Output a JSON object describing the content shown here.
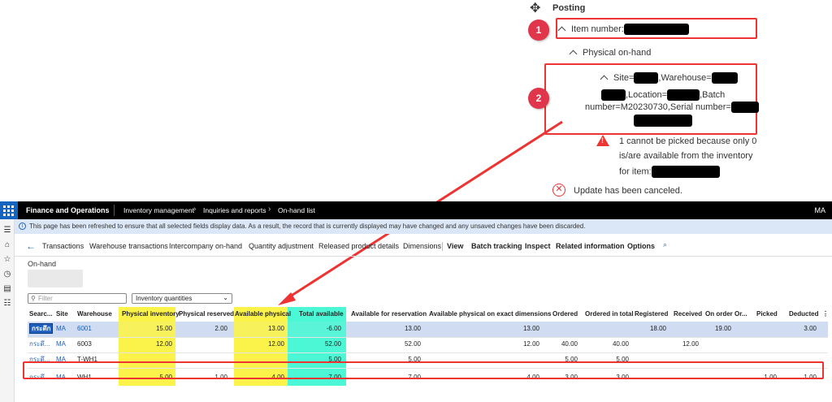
{
  "posting": {
    "title": "Posting",
    "item_number_label": "Item number:",
    "physical_onhand_label": "Physical on-hand",
    "dim_site": "Site=",
    "dim_warehouse": ",Warehouse=",
    "dim_location": ",Location=",
    "dim_batch_1": ",Batch",
    "dim_batch_2": "number=M20230730,Serial number=",
    "warning_1": "1 cannot be picked because only 0",
    "warning_2": "is/are available from the inventory",
    "warning_3": "for item:",
    "cancel_text": "Update has been canceled.",
    "badge_1": "1",
    "badge_2": "2"
  },
  "topbar": {
    "app_name": "Finance and Operations",
    "breadcrumb": [
      "Inventory management",
      "Inquiries and reports",
      "On-hand list"
    ],
    "user": "MA"
  },
  "infobar": {
    "message": "This page has been refreshed to ensure that all selected fields display data. As a result, the record that is currently displayed may have changed and any unsaved changes have been discarded."
  },
  "actions": {
    "transactions": "Transactions",
    "warehouse_transactions": "Warehouse transactions",
    "intercompany": "Intercompany on-hand",
    "quantity_adjustment": "Quantity adjustment",
    "released_product": "Released product details",
    "dimensions": "Dimensions",
    "view": "View",
    "batch_tracking": "Batch tracking",
    "inspect": "Inspect",
    "related": "Related information",
    "options": "Options"
  },
  "page": {
    "label": "On-hand"
  },
  "filter": {
    "placeholder": "Filter"
  },
  "view_select": {
    "value": "Inventory quantities"
  },
  "grid": {
    "headers": {
      "search": "Searc...",
      "site": "Site",
      "warehouse": "Warehouse",
      "physical_inventory": "Physical inventory",
      "physical_reserved": "Physical reserved",
      "available_physical": "Available physical",
      "total_available": "Total available",
      "available_for_reservation": "Available for reservation",
      "available_physical_exact": "Available physical on exact dimensions",
      "ordered": "Ordered",
      "ordered_in_total": "Ordered in total",
      "registered": "Registered",
      "received": "Received",
      "on_order": "On order",
      "or": "Or...",
      "picked": "Picked",
      "deducted": "Deducted"
    },
    "rows": [
      {
        "search": "กระดึก",
        "site": "MA",
        "warehouse": "6001",
        "physical_inventory": "15.00",
        "physical_reserved": "2.00",
        "available_physical": "13.00",
        "total_available": "-6.00",
        "available_for_reservation": "13.00",
        "available_physical_exact": "13.00",
        "ordered": "",
        "ordered_in_total": "",
        "registered": "18.00",
        "received": "",
        "on_order": "19.00",
        "picked": "",
        "deducted": "3.00"
      },
      {
        "search": "กระดึ...",
        "site": "MA",
        "warehouse": "6003",
        "physical_inventory": "12.00",
        "physical_reserved": "",
        "available_physical": "12.00",
        "total_available": "52.00",
        "available_for_reservation": "52.00",
        "available_physical_exact": "12.00",
        "ordered": "40.00",
        "ordered_in_total": "40.00",
        "registered": "",
        "received": "12.00",
        "on_order": "",
        "picked": "",
        "deducted": ""
      },
      {
        "search": "กระดึ...",
        "site": "MA",
        "warehouse": "T-WH1",
        "physical_inventory": "",
        "physical_reserved": "",
        "available_physical": "",
        "total_available": "5.00",
        "available_for_reservation": "5.00",
        "available_physical_exact": "",
        "ordered": "5.00",
        "ordered_in_total": "5.00",
        "registered": "",
        "received": "",
        "on_order": "",
        "picked": "",
        "deducted": ""
      },
      {
        "search": "กระดึ...",
        "site": "MA",
        "warehouse": "WH1",
        "physical_inventory": "5.00",
        "physical_reserved": "1.00",
        "available_physical": "4.00",
        "total_available": "7.00",
        "available_for_reservation": "7.00",
        "available_physical_exact": "4.00",
        "ordered": "3.00",
        "ordered_in_total": "3.00",
        "registered": "",
        "received": "",
        "on_order": "",
        "picked": "1.00",
        "deducted": "1.00"
      }
    ]
  },
  "colors": {
    "annotation_red": "#e33333",
    "highlight_yellow": "#fbf34a",
    "highlight_teal": "#4cf7d6",
    "brand_blue": "#1565c0"
  }
}
